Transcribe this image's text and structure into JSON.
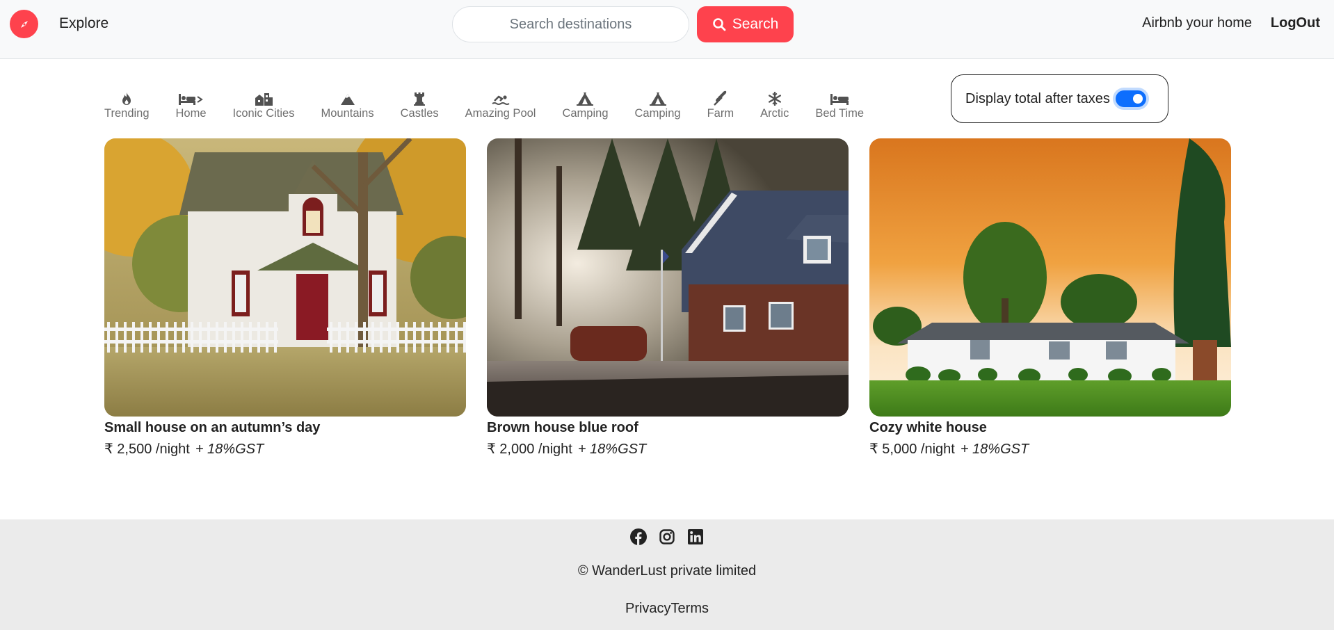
{
  "navbar": {
    "brand_icon": "compass-icon",
    "explore_label": "Explore",
    "search_placeholder": "Search destinations",
    "search_button_label": "Search",
    "host_link": "Airbnb your home",
    "logout_link": "LogOut",
    "accent_color": "#fe424d"
  },
  "filters": [
    {
      "label": "Trending",
      "icon": "fire-icon"
    },
    {
      "label": "Home",
      "icon": "bed-icon"
    },
    {
      "label": "Iconic Cities",
      "icon": "city-icon"
    },
    {
      "label": "Mountains",
      "icon": "mountain-icon"
    },
    {
      "label": "Castles",
      "icon": "chess-rook-icon"
    },
    {
      "label": "Amazing Pool",
      "icon": "swimmer-icon"
    },
    {
      "label": "Camping",
      "icon": "tent-icon"
    },
    {
      "label": "Camping",
      "icon": "tent-icon"
    },
    {
      "label": "Farm",
      "icon": "wheat-icon"
    },
    {
      "label": "Arctic",
      "icon": "snowflake-icon"
    },
    {
      "label": "Bed Time",
      "icon": "bed-icon"
    }
  ],
  "tax_toggle": {
    "label": "Display total after taxes",
    "enabled": true,
    "switch_color": "#0d6efd"
  },
  "listings": [
    {
      "title": "Small house on an autumn’s day",
      "price": "₹ 2,500 /night",
      "tax": "+ 18%GST",
      "image": "white-house-autumn-photo"
    },
    {
      "title": "Brown house blue roof",
      "price": "₹ 2,000 /night",
      "tax": "+ 18%GST",
      "image": "brown-house-blue-roof-photo"
    },
    {
      "title": "Cozy white house",
      "price": "₹ 5,000 /night",
      "tax": "+ 18%GST",
      "image": "cozy-white-house-sunset-photo"
    }
  ],
  "footer": {
    "socials": [
      "facebook-icon",
      "instagram-icon",
      "linkedin-icon"
    ],
    "copyright": "© WanderLust private limited",
    "links": "PrivacyTerms"
  }
}
